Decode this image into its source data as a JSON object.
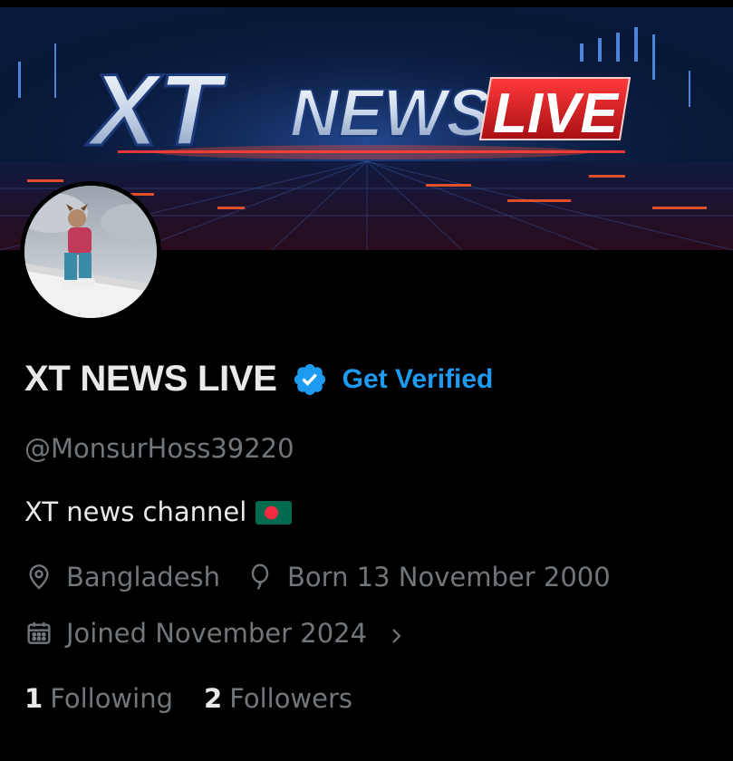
{
  "banner": {
    "logo_part1": "XT",
    "logo_part2": "NEWS",
    "logo_part3": "LIVE"
  },
  "profile": {
    "display_name": "XT NEWS LIVE",
    "verify_label": "Get Verified",
    "handle": "@MonsurHoss39220",
    "bio": "XT news channel",
    "location": "Bangladesh",
    "born": "Born 13 November 2000",
    "joined": "Joined November 2024",
    "following_count": "1",
    "following_label": "Following",
    "followers_count": "2",
    "followers_label": "Followers"
  },
  "colors": {
    "accent": "#1d9bf0",
    "muted": "#71767b",
    "text": "#e7e9ea",
    "background": "#000000",
    "live_red": "#d11a1a"
  },
  "icons": {
    "verified": "verified-badge-icon",
    "location": "location-pin-icon",
    "birthday": "balloon-icon",
    "calendar": "calendar-icon",
    "chevron": "chevron-right-icon",
    "flag": "bangladesh-flag-icon"
  }
}
